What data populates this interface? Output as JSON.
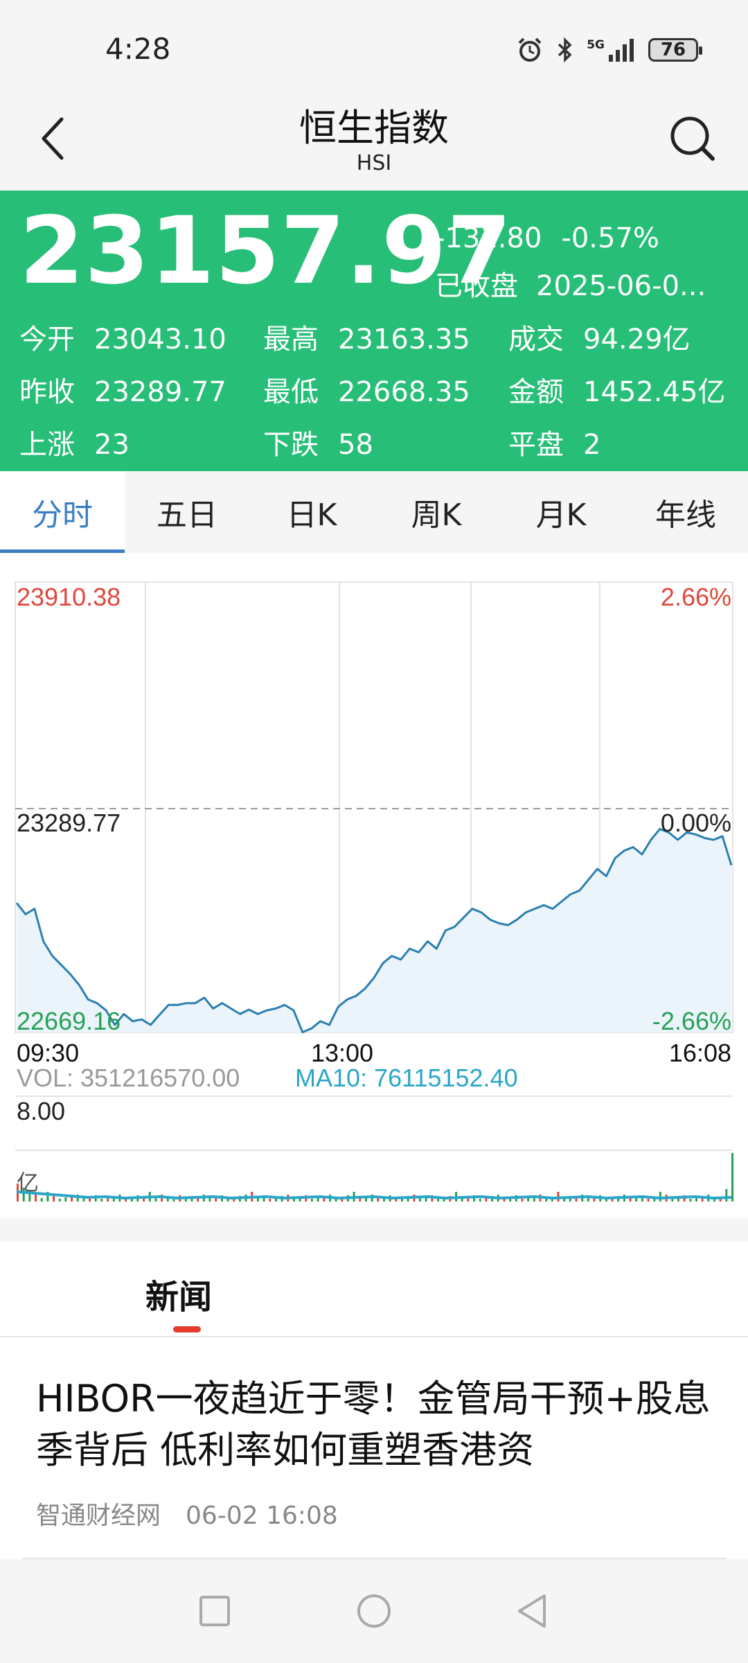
{
  "status": {
    "time": "4:28",
    "network": "5G",
    "battery": "76"
  },
  "header": {
    "title": "恒生指数",
    "subtitle": "HSI"
  },
  "quote": {
    "price": "23157.97",
    "change": "-131.80",
    "change_pct": "-0.57%",
    "state": "已收盘",
    "datetime": "2025-06-0...",
    "stats": [
      {
        "label": "今开",
        "value": "23043.10"
      },
      {
        "label": "最高",
        "value": "23163.35"
      },
      {
        "label": "成交",
        "value": "94.29亿"
      },
      {
        "label": "昨收",
        "value": "23289.77"
      },
      {
        "label": "最低",
        "value": "22668.35"
      },
      {
        "label": "金额",
        "value": "1452.45亿"
      },
      {
        "label": "上涨",
        "value": "23"
      },
      {
        "label": "下跌",
        "value": "58"
      },
      {
        "label": "平盘",
        "value": "2"
      }
    ],
    "colors": {
      "panel": "#27be77"
    }
  },
  "tabs": [
    {
      "label": "分时",
      "active": true
    },
    {
      "label": "五日",
      "active": false
    },
    {
      "label": "日K",
      "active": false
    },
    {
      "label": "周K",
      "active": false
    },
    {
      "label": "月K",
      "active": false
    },
    {
      "label": "年线",
      "active": false
    }
  ],
  "chart_data": {
    "type": "line",
    "axis_labels": {
      "top_price": "23910.38",
      "mid_price": "23289.77",
      "bottom_price": "22669.16",
      "top_pct": "2.66%",
      "mid_pct": "0.00%",
      "bottom_pct": "-2.66%"
    },
    "ylim": [
      22669.16,
      23910.38
    ],
    "reference": 23289.77,
    "x_ticks": [
      "09:30",
      "13:00",
      "16:08"
    ],
    "price_series": [
      23026,
      22995,
      23010,
      22920,
      22880,
      22855,
      22830,
      22800,
      22760,
      22750,
      22730,
      22690,
      22720,
      22700,
      22705,
      22690,
      22718,
      22745,
      22745,
      22750,
      22750,
      22765,
      22735,
      22750,
      22735,
      22720,
      22732,
      22720,
      22730,
      22735,
      22745,
      22730,
      22670,
      22680,
      22700,
      22690,
      22740,
      22760,
      22770,
      22790,
      22820,
      22860,
      22880,
      22870,
      22900,
      22890,
      22920,
      22900,
      22950,
      22960,
      22985,
      23010,
      23000,
      22980,
      22970,
      22965,
      22980,
      23000,
      23010,
      23020,
      23010,
      23030,
      23050,
      23060,
      23090,
      23120,
      23100,
      23150,
      23170,
      23180,
      23160,
      23200,
      23230,
      23220,
      23200,
      23220,
      23215,
      23205,
      23200,
      23210,
      23130
    ],
    "volume": {
      "label": "VOL: 351216570.00",
      "ma_label": "MA10: 76115152.40",
      "scale_top": "8.00",
      "unit": "亿",
      "colors": {
        "ma": "#2aa6c8",
        "up": "#e0463a",
        "down": "#27a055"
      }
    },
    "colors": {
      "line": "#2b7fb0",
      "up_label": "#e0463a",
      "down_label": "#27a055"
    }
  },
  "news": {
    "tab_label": "新闻",
    "items": [
      {
        "title": "HIBOR一夜趋近于零！金管局干预+股息季背后 低利率如何重塑香港资",
        "source": "智通财经网",
        "time": "06-02 16:08"
      }
    ]
  }
}
